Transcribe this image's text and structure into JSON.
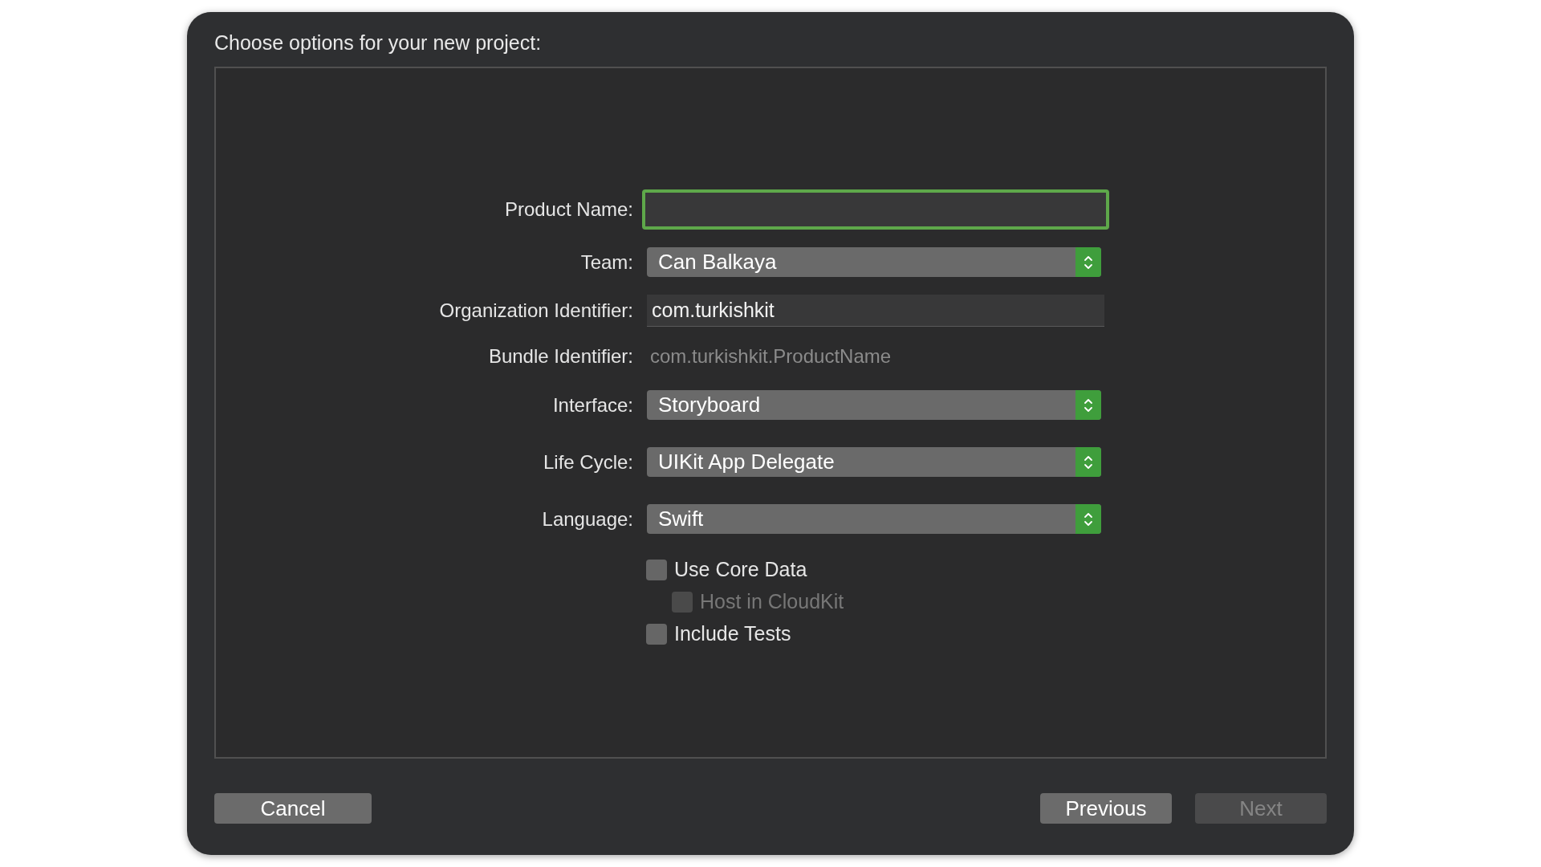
{
  "window": {
    "title": "Choose options for your new project:"
  },
  "fields": [
    {
      "kind": "text",
      "label": "Product Name:",
      "focused": true
    },
    {
      "kind": "popup",
      "label": "Team:",
      "value": "Can Balkaya"
    },
    {
      "kind": "text",
      "label": "Organization Identifier:",
      "value": "com.turkishkit",
      "focused": false
    },
    {
      "kind": "static",
      "label": "Bundle Identifier:",
      "value": "com.turkishkit.ProductName"
    },
    {
      "kind": "popup",
      "label": "Interface:",
      "value": "Storyboard"
    },
    {
      "kind": "popup",
      "label": "Life Cycle:",
      "value": "UIKit App Delegate"
    },
    {
      "kind": "popup",
      "label": "Language:",
      "value": "Swift"
    }
  ],
  "checkboxes": [
    {
      "label": "Use Core Data",
      "checked": false,
      "disabled": false,
      "children": [
        {
          "label": "Host in CloudKit",
          "checked": false,
          "disabled": true
        }
      ]
    },
    {
      "label": "Include Tests",
      "checked": false,
      "disabled": false
    }
  ],
  "buttons": {
    "left": [
      {
        "label": "Cancel",
        "disabled": false
      }
    ],
    "right": [
      {
        "label": "Previous",
        "disabled": false
      },
      {
        "label": "Next",
        "disabled": true
      }
    ]
  }
}
